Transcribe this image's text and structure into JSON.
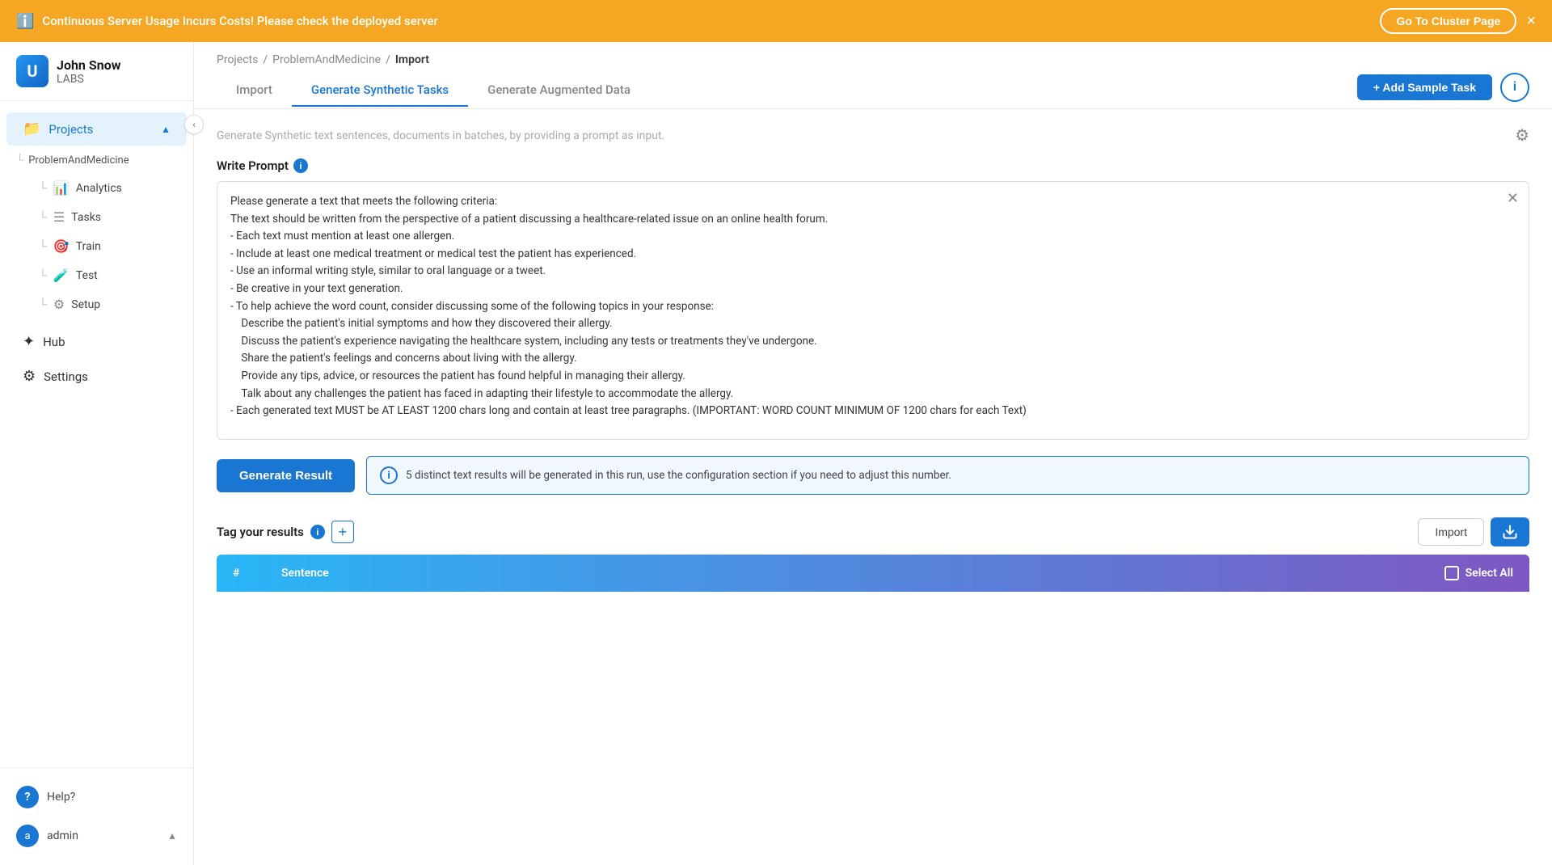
{
  "notif": {
    "message": "Continuous Server Usage Incurs Costs! Please check the deployed server",
    "go_cluster_label": "Go To Cluster Page",
    "close_label": "×"
  },
  "sidebar": {
    "logo": {
      "john": "John Snow",
      "labs": "LABS"
    },
    "projects_label": "Projects",
    "project_name": "ProblemAndMedicine",
    "sub_items": [
      {
        "label": "Analytics",
        "icon": "📊"
      },
      {
        "label": "Tasks",
        "icon": "☰"
      },
      {
        "label": "Train",
        "icon": "🎯"
      },
      {
        "label": "Test",
        "icon": "🧪"
      },
      {
        "label": "Setup",
        "icon": "⚙"
      }
    ],
    "hub_label": "Hub",
    "settings_label": "Settings",
    "help_label": "Help?",
    "admin_label": "admin"
  },
  "breadcrumb": {
    "projects": "Projects",
    "sep1": "/",
    "project": "ProblemAndMedicine",
    "sep2": "/",
    "current": "Import"
  },
  "tabs": [
    {
      "label": "Import",
      "active": false
    },
    {
      "label": "Generate Synthetic Tasks",
      "active": true
    },
    {
      "label": "Generate Augmented Data",
      "active": false
    }
  ],
  "toolbar": {
    "add_sample_label": "+ Add Sample Task"
  },
  "main": {
    "subtitle": "Generate Synthetic text sentences, documents in batches, by providing a prompt as input.",
    "write_prompt_label": "Write Prompt",
    "prompt_text": "Please generate a text that meets the following criteria:\nThe text should be written from the perspective of a patient discussing a healthcare-related issue on an online health forum.\n- Each text must mention at least one allergen.\n- Include at least one medical treatment or medical test the patient has experienced.\n- Use an informal writing style, similar to oral language or a tweet.\n- Be creative in your text generation.\n- To help achieve the word count, consider discussing some of the following topics in your response:\n    Describe the patient's initial symptoms and how they discovered their allergy.\n    Discuss the patient's experience navigating the healthcare system, including any tests or treatments they've undergone.\n    Share the patient's feelings and concerns about living with the allergy.\n    Provide any tips, advice, or resources the patient has found helpful in managing their allergy.\n    Talk about any challenges the patient has faced in adapting their lifestyle to accommodate the allergy.\n- Each generated text MUST be AT LEAST 1200 chars long and contain at least tree paragraphs. (IMPORTANT: WORD COUNT MINIMUM OF 1200 chars for each Text)",
    "generate_btn_label": "Generate Result",
    "generate_info": "5 distinct text results will be generated in this run, use the configuration section if you need to adjust this number.",
    "tag_results_label": "Tag your results",
    "import_btn_label": "Import",
    "table_headers": {
      "hash": "#",
      "sentence": "Sentence",
      "select_all": "Select All"
    }
  }
}
